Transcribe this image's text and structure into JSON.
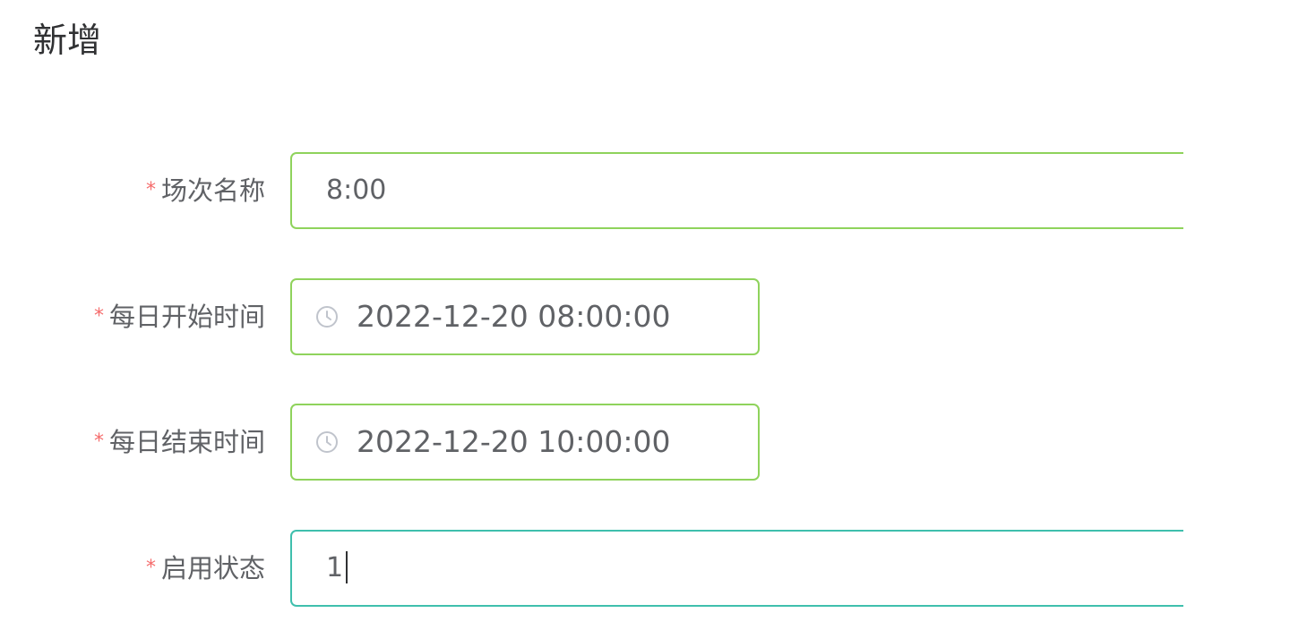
{
  "dialog": {
    "title": "新增"
  },
  "form": {
    "required_mark": "*",
    "session_name": {
      "label": "场次名称",
      "value": "8:00"
    },
    "daily_start_time": {
      "label": "每日开始时间",
      "value": "2022-12-20 08:00:00",
      "icon": "clock-icon"
    },
    "daily_end_time": {
      "label": "每日结束时间",
      "value": "2022-12-20 10:00:00",
      "icon": "clock-icon"
    },
    "enabled_status": {
      "label": "启用状态",
      "value": "1"
    }
  },
  "colors": {
    "valid_border": "#8fd35c",
    "focus_border": "#3fbfad",
    "required_star": "#f56c6c",
    "label_text": "#606266",
    "title_text": "#303133"
  }
}
